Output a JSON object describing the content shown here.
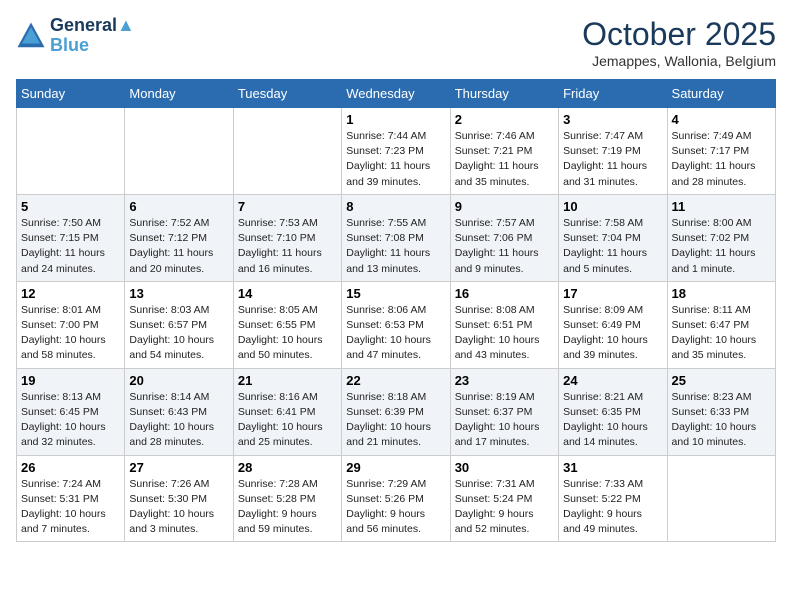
{
  "header": {
    "logo_line1": "General",
    "logo_line2": "Blue",
    "month": "October 2025",
    "location": "Jemappes, Wallonia, Belgium"
  },
  "days_of_week": [
    "Sunday",
    "Monday",
    "Tuesday",
    "Wednesday",
    "Thursday",
    "Friday",
    "Saturday"
  ],
  "weeks": [
    [
      {
        "day": "",
        "info": ""
      },
      {
        "day": "",
        "info": ""
      },
      {
        "day": "",
        "info": ""
      },
      {
        "day": "1",
        "info": "Sunrise: 7:44 AM\nSunset: 7:23 PM\nDaylight: 11 hours\nand 39 minutes."
      },
      {
        "day": "2",
        "info": "Sunrise: 7:46 AM\nSunset: 7:21 PM\nDaylight: 11 hours\nand 35 minutes."
      },
      {
        "day": "3",
        "info": "Sunrise: 7:47 AM\nSunset: 7:19 PM\nDaylight: 11 hours\nand 31 minutes."
      },
      {
        "day": "4",
        "info": "Sunrise: 7:49 AM\nSunset: 7:17 PM\nDaylight: 11 hours\nand 28 minutes."
      }
    ],
    [
      {
        "day": "5",
        "info": "Sunrise: 7:50 AM\nSunset: 7:15 PM\nDaylight: 11 hours\nand 24 minutes."
      },
      {
        "day": "6",
        "info": "Sunrise: 7:52 AM\nSunset: 7:12 PM\nDaylight: 11 hours\nand 20 minutes."
      },
      {
        "day": "7",
        "info": "Sunrise: 7:53 AM\nSunset: 7:10 PM\nDaylight: 11 hours\nand 16 minutes."
      },
      {
        "day": "8",
        "info": "Sunrise: 7:55 AM\nSunset: 7:08 PM\nDaylight: 11 hours\nand 13 minutes."
      },
      {
        "day": "9",
        "info": "Sunrise: 7:57 AM\nSunset: 7:06 PM\nDaylight: 11 hours\nand 9 minutes."
      },
      {
        "day": "10",
        "info": "Sunrise: 7:58 AM\nSunset: 7:04 PM\nDaylight: 11 hours\nand 5 minutes."
      },
      {
        "day": "11",
        "info": "Sunrise: 8:00 AM\nSunset: 7:02 PM\nDaylight: 11 hours\nand 1 minute."
      }
    ],
    [
      {
        "day": "12",
        "info": "Sunrise: 8:01 AM\nSunset: 7:00 PM\nDaylight: 10 hours\nand 58 minutes."
      },
      {
        "day": "13",
        "info": "Sunrise: 8:03 AM\nSunset: 6:57 PM\nDaylight: 10 hours\nand 54 minutes."
      },
      {
        "day": "14",
        "info": "Sunrise: 8:05 AM\nSunset: 6:55 PM\nDaylight: 10 hours\nand 50 minutes."
      },
      {
        "day": "15",
        "info": "Sunrise: 8:06 AM\nSunset: 6:53 PM\nDaylight: 10 hours\nand 47 minutes."
      },
      {
        "day": "16",
        "info": "Sunrise: 8:08 AM\nSunset: 6:51 PM\nDaylight: 10 hours\nand 43 minutes."
      },
      {
        "day": "17",
        "info": "Sunrise: 8:09 AM\nSunset: 6:49 PM\nDaylight: 10 hours\nand 39 minutes."
      },
      {
        "day": "18",
        "info": "Sunrise: 8:11 AM\nSunset: 6:47 PM\nDaylight: 10 hours\nand 35 minutes."
      }
    ],
    [
      {
        "day": "19",
        "info": "Sunrise: 8:13 AM\nSunset: 6:45 PM\nDaylight: 10 hours\nand 32 minutes."
      },
      {
        "day": "20",
        "info": "Sunrise: 8:14 AM\nSunset: 6:43 PM\nDaylight: 10 hours\nand 28 minutes."
      },
      {
        "day": "21",
        "info": "Sunrise: 8:16 AM\nSunset: 6:41 PM\nDaylight: 10 hours\nand 25 minutes."
      },
      {
        "day": "22",
        "info": "Sunrise: 8:18 AM\nSunset: 6:39 PM\nDaylight: 10 hours\nand 21 minutes."
      },
      {
        "day": "23",
        "info": "Sunrise: 8:19 AM\nSunset: 6:37 PM\nDaylight: 10 hours\nand 17 minutes."
      },
      {
        "day": "24",
        "info": "Sunrise: 8:21 AM\nSunset: 6:35 PM\nDaylight: 10 hours\nand 14 minutes."
      },
      {
        "day": "25",
        "info": "Sunrise: 8:23 AM\nSunset: 6:33 PM\nDaylight: 10 hours\nand 10 minutes."
      }
    ],
    [
      {
        "day": "26",
        "info": "Sunrise: 7:24 AM\nSunset: 5:31 PM\nDaylight: 10 hours\nand 7 minutes."
      },
      {
        "day": "27",
        "info": "Sunrise: 7:26 AM\nSunset: 5:30 PM\nDaylight: 10 hours\nand 3 minutes."
      },
      {
        "day": "28",
        "info": "Sunrise: 7:28 AM\nSunset: 5:28 PM\nDaylight: 9 hours\nand 59 minutes."
      },
      {
        "day": "29",
        "info": "Sunrise: 7:29 AM\nSunset: 5:26 PM\nDaylight: 9 hours\nand 56 minutes."
      },
      {
        "day": "30",
        "info": "Sunrise: 7:31 AM\nSunset: 5:24 PM\nDaylight: 9 hours\nand 52 minutes."
      },
      {
        "day": "31",
        "info": "Sunrise: 7:33 AM\nSunset: 5:22 PM\nDaylight: 9 hours\nand 49 minutes."
      },
      {
        "day": "",
        "info": ""
      }
    ]
  ]
}
